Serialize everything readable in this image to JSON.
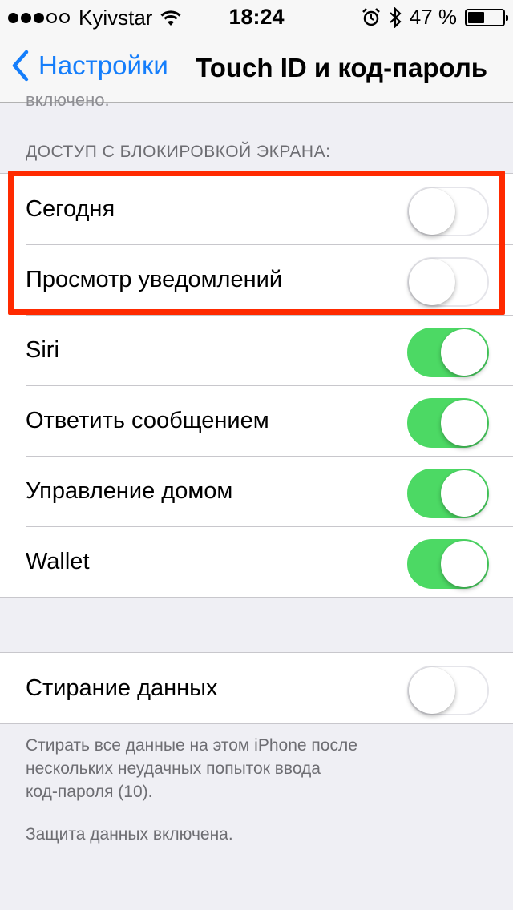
{
  "status_bar": {
    "carrier": "Kyivstar",
    "time": "18:24",
    "battery_percent": "47 %",
    "signal_bars_filled": 3,
    "battery_level": 0.47
  },
  "nav": {
    "back_label": "Настройки",
    "title": "Touch ID и код-пароль"
  },
  "cut_text": "включено.",
  "lock_screen_section": {
    "header": "ДОСТУП С БЛОКИРОВКОЙ ЭКРАНА:",
    "items": [
      {
        "label": "Сегодня",
        "on": false
      },
      {
        "label": "Просмотр уведомлений",
        "on": false
      },
      {
        "label": "Siri",
        "on": true
      },
      {
        "label": "Ответить сообщением",
        "on": true
      },
      {
        "label": "Управление домом",
        "on": true
      },
      {
        "label": "Wallet",
        "on": true
      }
    ]
  },
  "erase_section": {
    "label": "Стирание данных",
    "on": false,
    "footer_line1": "Стирать все данные на этом iPhone после",
    "footer_line2": "нескольких неудачных попыток ввода",
    "footer_line3": "код-пароля (10).",
    "protection_note": "Защита данных включена."
  },
  "colors": {
    "accent": "#157efb",
    "toggle_on": "#4cd964",
    "annotation_red": "#ff2a00",
    "background": "#efeff4"
  }
}
